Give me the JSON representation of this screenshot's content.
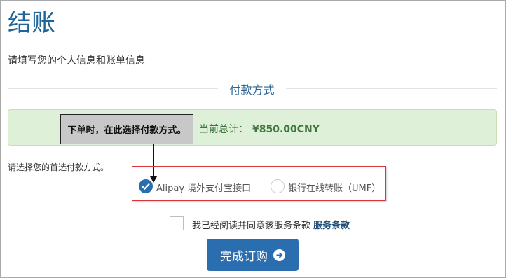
{
  "page": {
    "title": "结账",
    "intro": "请填写您的个人信息和账单信息"
  },
  "payment": {
    "section_title": "付款方式",
    "total_label": "当前总计：",
    "total_amount": "¥850.00CNY",
    "annotation": "下单时，在此选择付款方式。",
    "prompt": "请选择您的首选付款方式。",
    "options": [
      {
        "label": "Alipay 境外支付宝接口",
        "selected": true
      },
      {
        "label": "银行在线转账（UMF）",
        "selected": false
      }
    ]
  },
  "agreement": {
    "text": "我已经阅读并同意该服务条款",
    "link": "服务条款",
    "checked": false
  },
  "submit": {
    "label": "完成订购",
    "icon": "arrow-circle-right-icon"
  },
  "colors": {
    "primary": "#2a6eb0",
    "success_bg": "#dff0d8",
    "success_text": "#3c763d",
    "highlight_border": "#d9363e"
  }
}
